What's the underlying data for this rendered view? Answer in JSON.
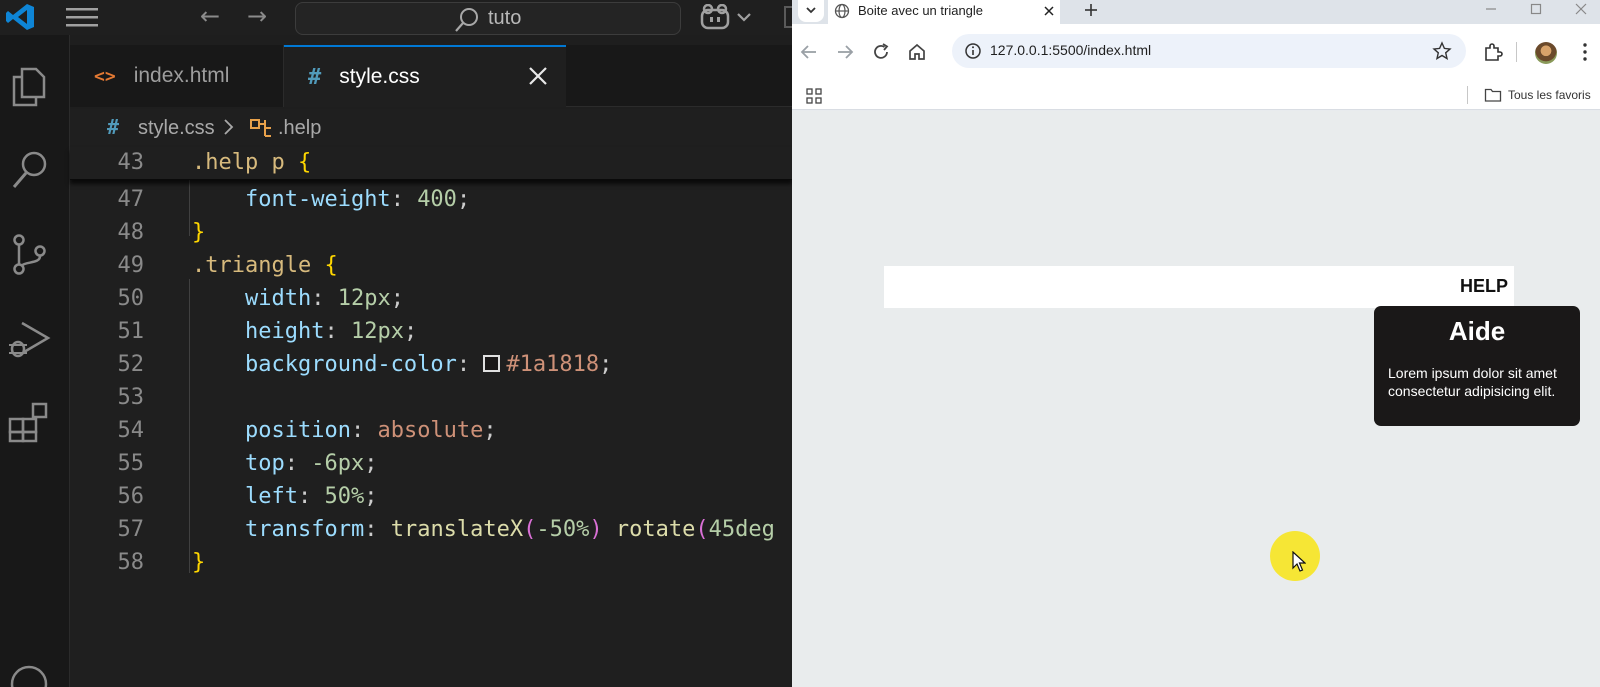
{
  "vscode": {
    "search_text": "tuto",
    "tabs": [
      {
        "label": "index.html",
        "icon": "html-file-icon",
        "active": false
      },
      {
        "label": "style.css",
        "icon": "css-file-icon",
        "active": true
      }
    ],
    "tab_icons": {
      "html": "<>",
      "css": "#"
    },
    "breadcrumb": {
      "file": "style.css",
      "symbol": ".help",
      "file_icon": "#"
    },
    "code": {
      "l43": {
        "num": "43",
        "selector": ".help p",
        "brace": "{"
      },
      "l47": {
        "num": "47",
        "prop": "font-weight",
        "colon": ": ",
        "value": "400",
        "semi": ";"
      },
      "l48": {
        "num": "48",
        "brace": "}"
      },
      "l49": {
        "num": "49",
        "selector": ".triangle",
        "brace": "{"
      },
      "l50": {
        "num": "50",
        "prop": "width",
        "colon": ": ",
        "value": "12px",
        "semi": ";"
      },
      "l51": {
        "num": "51",
        "prop": "height",
        "colon": ": ",
        "value": "12px",
        "semi": ";"
      },
      "l52": {
        "num": "52",
        "prop": "background-color",
        "colon": ": ",
        "value": "#1a1818",
        "semi": ";"
      },
      "l53": {
        "num": "53"
      },
      "l54": {
        "num": "54",
        "prop": "position",
        "colon": ": ",
        "value": "absolute",
        "semi": ";"
      },
      "l55": {
        "num": "55",
        "prop": "top",
        "colon": ": ",
        "value": "-6px",
        "semi": ";"
      },
      "l56": {
        "num": "56",
        "prop": "left",
        "colon": ": ",
        "value": "50%",
        "semi": ";"
      },
      "l57": {
        "num": "57",
        "prop": "transform",
        "colon": ": ",
        "fn1": "translateX",
        "p_open": "(",
        "arg1": "-50%",
        "p_close": ")",
        "fn2": "rotate",
        "p_open2": "(",
        "arg2": "45deg"
      },
      "l58": {
        "num": "58",
        "brace": "}"
      }
    },
    "colors": {
      "accent": "#0078d4",
      "swatch": "#1a1818"
    }
  },
  "chrome": {
    "tab_title": "Boite avec un triangle",
    "url": "127.0.0.1:5500/index.html",
    "bookmarks_label": "Tous les favoris"
  },
  "page": {
    "help_label": "HELP",
    "tooltip_title": "Aide",
    "tooltip_text": "Lorem ipsum dolor sit amet consectetur adipisicing elit."
  }
}
